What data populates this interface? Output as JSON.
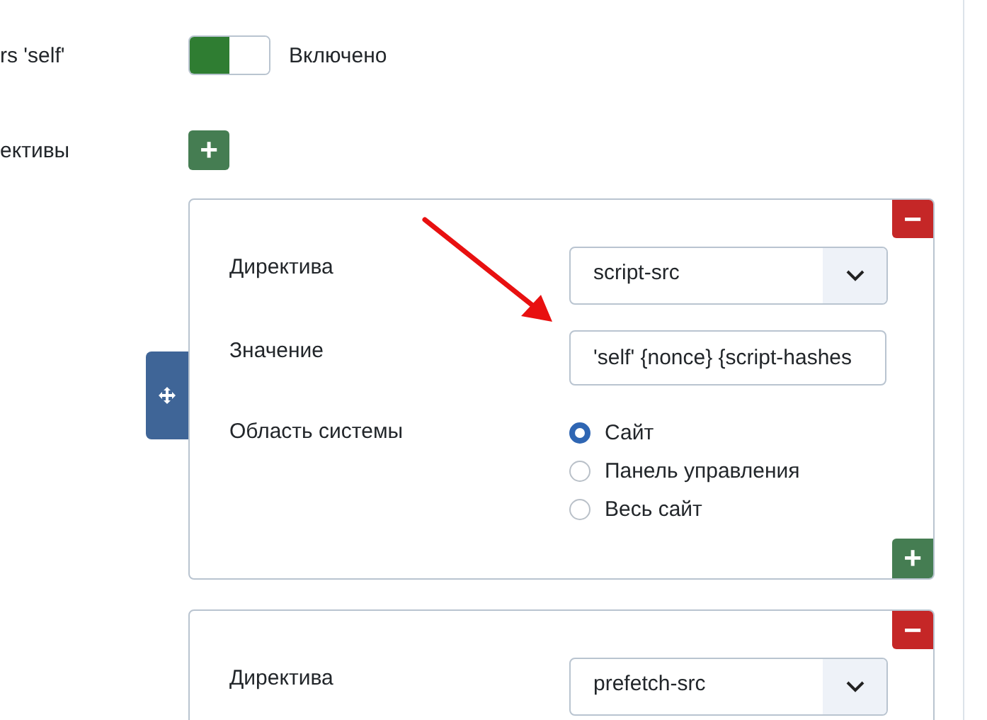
{
  "settings": [
    {
      "label": "rs 'self'",
      "kind": "toggle",
      "on": true,
      "state_text": "Включено"
    },
    {
      "label": "ективы",
      "kind": "add",
      "button": "+"
    }
  ],
  "directives": [
    {
      "remove": "−",
      "rows": [
        {
          "kind": "select",
          "label": "Директива",
          "value": "script-src"
        },
        {
          "kind": "text",
          "label": "Значение",
          "value": "'self' {nonce} {script-hashes"
        },
        {
          "kind": "radio",
          "label": "Область системы",
          "options": [
            {
              "label": "Сайт",
              "selected": true
            },
            {
              "label": "Панель управления",
              "selected": false
            },
            {
              "label": "Весь сайт",
              "selected": false
            }
          ]
        }
      ],
      "add": "+",
      "drag_handle": true
    },
    {
      "remove": "−",
      "rows": [
        {
          "kind": "select",
          "label": "Директива",
          "value": "prefetch-src"
        }
      ],
      "drag_handle": false
    }
  ]
}
